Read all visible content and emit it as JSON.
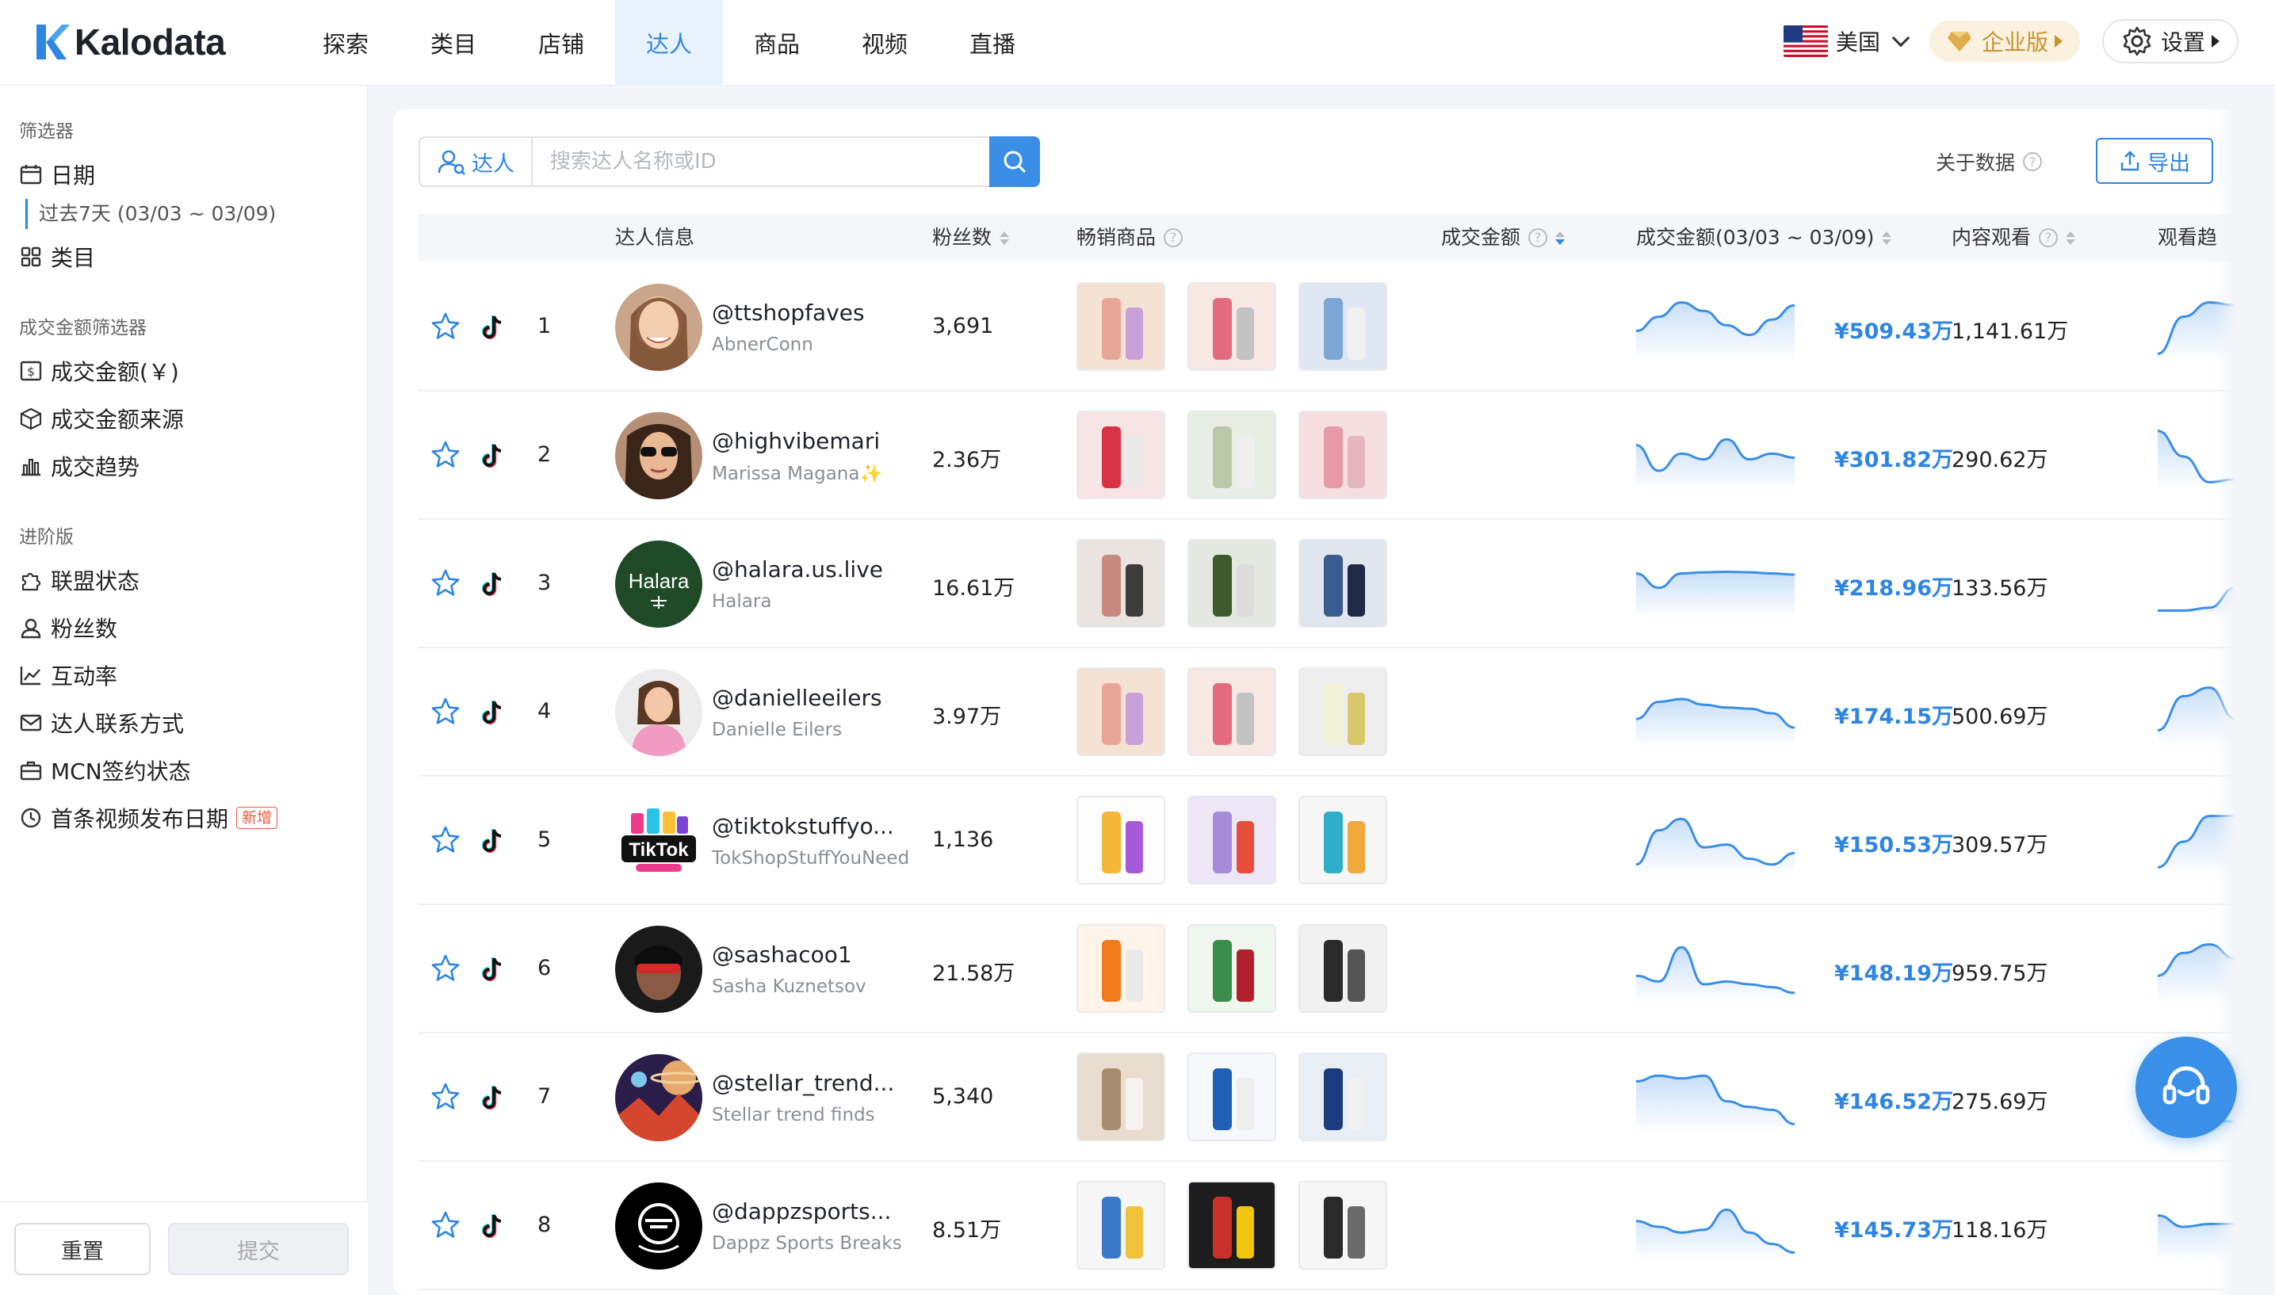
{
  "brand": {
    "name": "Kalodata",
    "accent": "#2f86e0"
  },
  "nav": [
    {
      "label": "探索",
      "active": false
    },
    {
      "label": "类目",
      "active": false
    },
    {
      "label": "店铺",
      "active": false
    },
    {
      "label": "达人",
      "active": true
    },
    {
      "label": "商品",
      "active": false
    },
    {
      "label": "视频",
      "active": false
    },
    {
      "label": "直播",
      "active": false
    }
  ],
  "topright": {
    "region": "美国",
    "enterprise": "企业版",
    "settings": "设置"
  },
  "sidebar": {
    "filters_title": "筛选器",
    "date_label": "日期",
    "date_value": "过去7天 (03/03 ~ 03/09)",
    "category_label": "类目",
    "gmv_filters_title": "成交金额筛选器",
    "gmv_items": [
      "成交金额(￥)",
      "成交金额来源",
      "成交趋势"
    ],
    "advanced_title": "进阶版",
    "advanced_items": [
      "联盟状态",
      "粉丝数",
      "互动率",
      "达人联系方式",
      "MCN签约状态",
      "首条视频发布日期"
    ],
    "new_badge": "新增",
    "reset": "重置",
    "submit": "提交"
  },
  "search": {
    "type": "达人",
    "placeholder": "搜索达人名称或ID"
  },
  "about": "关于数据",
  "export": "导出",
  "table": {
    "headers": {
      "info": "达人信息",
      "fans": "粉丝数",
      "products": "畅销商品",
      "gmv": "成交金额",
      "gmv_trend": "成交金额(03/03 ~ 03/09)",
      "views": "内容观看",
      "views_trend": "观看趋"
    },
    "rows": [
      {
        "rank": "1",
        "handle": "@ttshopfaves",
        "nick": "AbnerConn",
        "fans": "3,691",
        "gmv": "¥509.43万",
        "views": "1,141.61万",
        "trend": [
          0.55,
          0.3,
          0.05,
          0.2,
          0.45,
          0.62,
          0.35,
          0.1
        ],
        "vtrend": [
          0.95,
          0.3,
          0.05,
          0.1
        ]
      },
      {
        "rank": "2",
        "handle": "@highvibemari",
        "nick": "Marissa Magana✨",
        "fans": "2.36万",
        "gmv": "¥301.82万",
        "views": "290.62万",
        "trend": [
          0.3,
          0.75,
          0.45,
          0.55,
          0.2,
          0.55,
          0.45,
          0.52
        ],
        "vtrend": [
          0.05,
          0.5,
          0.95,
          0.9
        ]
      },
      {
        "rank": "3",
        "handle": "@halara.us.live",
        "nick": "Halara",
        "fans": "16.61万",
        "gmv": "¥218.96万",
        "views": "133.56万",
        "trend": [
          0.3,
          0.55,
          0.3,
          0.28,
          0.27,
          0.28,
          0.3,
          0.32
        ],
        "vtrend": [
          0.95,
          0.95,
          0.9,
          0.55
        ]
      },
      {
        "rank": "4",
        "handle": "@danielleeilers",
        "nick": "Danielle Eilers",
        "fans": "3.97万",
        "gmv": "¥174.15万",
        "views": "500.69万",
        "trend": [
          0.6,
          0.3,
          0.25,
          0.35,
          0.4,
          0.42,
          0.5,
          0.75
        ],
        "vtrend": [
          0.8,
          0.2,
          0.05,
          0.6
        ]
      },
      {
        "rank": "5",
        "handle": "@tiktokstuffyo...",
        "nick": "TokShopStuffYouNeed",
        "fans": "1,136",
        "gmv": "¥150.53万",
        "views": "309.57万",
        "trend": [
          0.9,
          0.3,
          0.1,
          0.6,
          0.55,
          0.8,
          0.9,
          0.7
        ],
        "vtrend": [
          0.95,
          0.5,
          0.05,
          0.05
        ]
      },
      {
        "rank": "6",
        "handle": "@sashacoo1",
        "nick": "Sasha Kuznetsov",
        "fans": "21.58万",
        "gmv": "¥148.19万",
        "views": "959.75万",
        "trend": [
          0.6,
          0.7,
          0.1,
          0.75,
          0.7,
          0.75,
          0.8,
          0.9
        ],
        "vtrend": [
          0.6,
          0.2,
          0.05,
          0.3
        ]
      },
      {
        "rank": "7",
        "handle": "@stellar_trend...",
        "nick": "Stellar trend finds",
        "fans": "5,340",
        "gmv": "¥146.52万",
        "views": "275.69万",
        "trend": [
          0.2,
          0.1,
          0.15,
          0.1,
          0.55,
          0.65,
          0.7,
          0.95
        ],
        "vtrend": [
          0.8,
          0.9,
          0.9,
          0.9
        ]
      },
      {
        "rank": "8",
        "handle": "@dappzsports...",
        "nick": "Dappz Sports Breaks",
        "fans": "8.51万",
        "gmv": "¥145.73万",
        "views": "118.16万",
        "trend": [
          0.4,
          0.5,
          0.6,
          0.55,
          0.2,
          0.6,
          0.8,
          0.95
        ],
        "vtrend": [
          0.3,
          0.5,
          0.45,
          0.45
        ]
      }
    ]
  }
}
